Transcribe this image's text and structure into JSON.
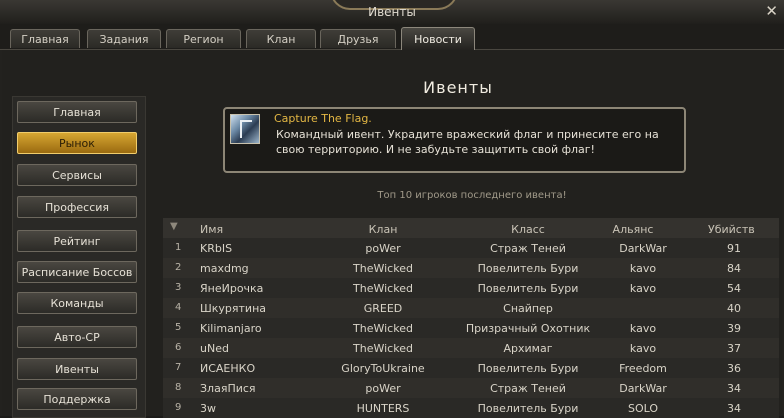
{
  "window": {
    "title": "Ивенты",
    "close_label": "✕"
  },
  "tabs": [
    {
      "label": "Главная"
    },
    {
      "label": "Задания"
    },
    {
      "label": "Регион"
    },
    {
      "label": "Клан"
    },
    {
      "label": "Друзья"
    },
    {
      "label": "Новости"
    }
  ],
  "sidebar": {
    "items": [
      {
        "label": "Главная"
      },
      {
        "label": "Рынок"
      },
      {
        "label": "Сервисы"
      },
      {
        "label": "Профессия"
      },
      {
        "label": "Рейтинг"
      },
      {
        "label": "Расписание Боссов"
      },
      {
        "label": "Команды"
      },
      {
        "label": "Авто-СР"
      },
      {
        "label": "Ивенты"
      },
      {
        "label": "Поддержка"
      }
    ]
  },
  "main": {
    "title": "Ивенты",
    "event": {
      "name": "Capture The Flag.",
      "description": " Командный ивент. Украдите вражеский флаг и принесите его на свою территорию. И не забудьте защитить свой флаг!",
      "icon": "flag-event-icon"
    },
    "top_caption": "Топ 10 игроков последнего ивента!"
  },
  "table": {
    "columns": [
      "Имя",
      "Клан",
      "Класс",
      "Альянс",
      "Убийств"
    ],
    "rows": [
      [
        "1",
        "KRbIS",
        "poWer",
        "Страж Теней",
        "DarkWar",
        "91"
      ],
      [
        "2",
        "maxdmg",
        "TheWicked",
        "Повелитель Бури",
        "kavo",
        "84"
      ],
      [
        "3",
        "ЯнеИрочка",
        "TheWicked",
        "Повелитель Бури",
        "kavo",
        "54"
      ],
      [
        "4",
        "Шкурятина",
        "GREED",
        "Снайпер",
        "",
        "40"
      ],
      [
        "5",
        "Kilimanjaro",
        "TheWicked",
        "Призрачный Охотник",
        "kavo",
        "39"
      ],
      [
        "6",
        "uNed",
        "TheWicked",
        "Архимаг",
        "kavo",
        "37"
      ],
      [
        "7",
        "ИСАЕНКО",
        "GloryToUkraine",
        "Повелитель Бури",
        "Freedom",
        "36"
      ],
      [
        "8",
        "ЗлаяПися",
        "poWer",
        "Страж Теней",
        "DarkWar",
        "34"
      ],
      [
        "9",
        "3w",
        "HUNTERS",
        "Повелитель Бури",
        "SOLO",
        "34"
      ]
    ]
  }
}
